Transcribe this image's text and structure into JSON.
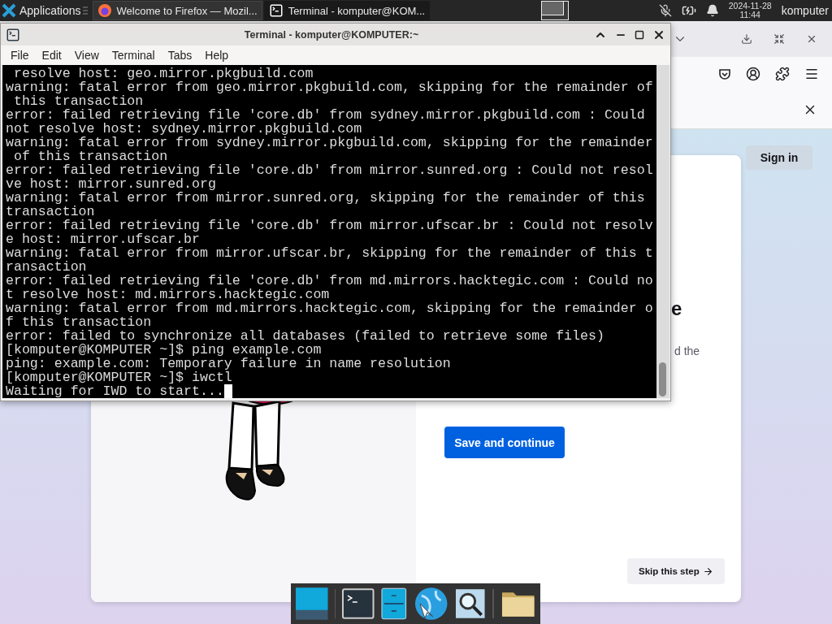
{
  "top_panel": {
    "menu_label": "Applications",
    "tasks": [
      {
        "title": "Welcome to Firefox — Mozil...",
        "selected": false
      },
      {
        "title": "Terminal - komputer@KOM...",
        "selected": true
      }
    ],
    "clock": {
      "date": "2024-11-28",
      "time": "11:44"
    },
    "user": "komputer"
  },
  "browser": {
    "sign_in": "Sign in",
    "heading_fragment": "e",
    "text_fragment": "d the",
    "primary_button": "Save and continue",
    "skip_button": "Skip this step"
  },
  "terminal": {
    "title": "Terminal - komputer@KOMPUTER:~",
    "menu": [
      "File",
      "Edit",
      "View",
      "Terminal",
      "Tabs",
      "Help"
    ],
    "lines": [
      " resolve host: geo.mirror.pkgbuild.com",
      "warning: fatal error from geo.mirror.pkgbuild.com, skipping for the remainder of",
      " this transaction",
      "error: failed retrieving file 'core.db' from sydney.mirror.pkgbuild.com : Could",
      "not resolve host: sydney.mirror.pkgbuild.com",
      "warning: fatal error from sydney.mirror.pkgbuild.com, skipping for the remainder",
      " of this transaction",
      "error: failed retrieving file 'core.db' from mirror.sunred.org : Could not resol",
      "ve host: mirror.sunred.org",
      "warning: fatal error from mirror.sunred.org, skipping for the remainder of this",
      "transaction",
      "error: failed retrieving file 'core.db' from mirror.ufscar.br : Could not resolv",
      "e host: mirror.ufscar.br",
      "warning: fatal error from mirror.ufscar.br, skipping for the remainder of this t",
      "ransaction",
      "error: failed retrieving file 'core.db' from md.mirrors.hacktegic.com : Could no",
      "t resolve host: md.mirrors.hacktegic.com",
      "warning: fatal error from md.mirrors.hacktegic.com, skipping for the remainder o",
      "f this transaction",
      "error: failed to synchronize all databases (failed to retrieve some files)",
      "[komputer@KOMPUTER ~]$ ping example.com",
      "ping: example.com: Temporary failure in name resolution",
      "[komputer@KOMPUTER ~]$ iwctl",
      "Waiting for IWD to start..."
    ]
  }
}
